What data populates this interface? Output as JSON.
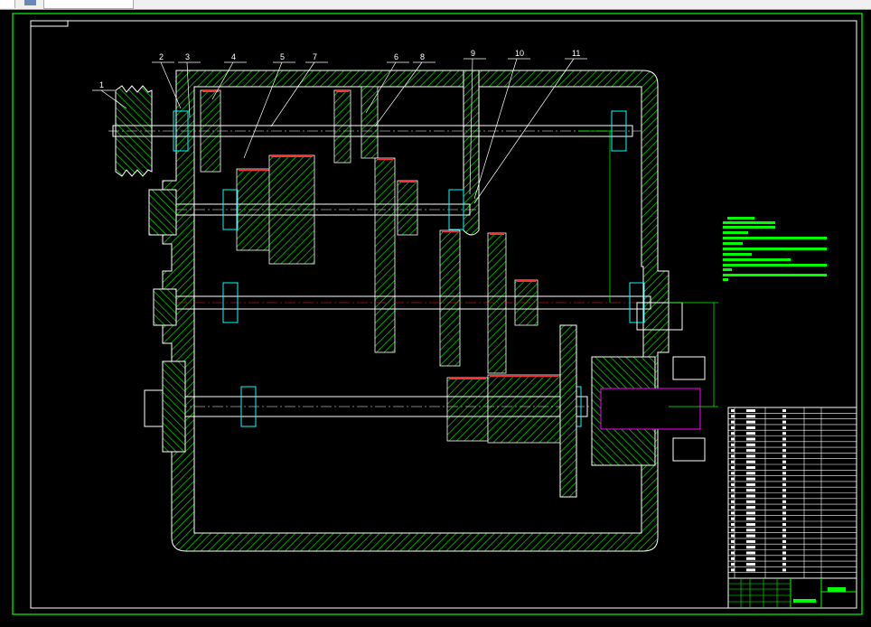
{
  "viewer": {
    "toolbar_icon": "layout-icon"
  },
  "colors": {
    "background": "#000000",
    "frame": "#00ff00",
    "hatch": "#00cc00",
    "outline": "#ffffff",
    "centerline": "#ff0000",
    "bearing": "#00ffff",
    "highlight": "#ff00ff"
  },
  "drawing": {
    "part_labels": [
      "1",
      "2",
      "3",
      "4",
      "5",
      "7",
      "6",
      "8",
      "9",
      "10",
      "11"
    ]
  }
}
